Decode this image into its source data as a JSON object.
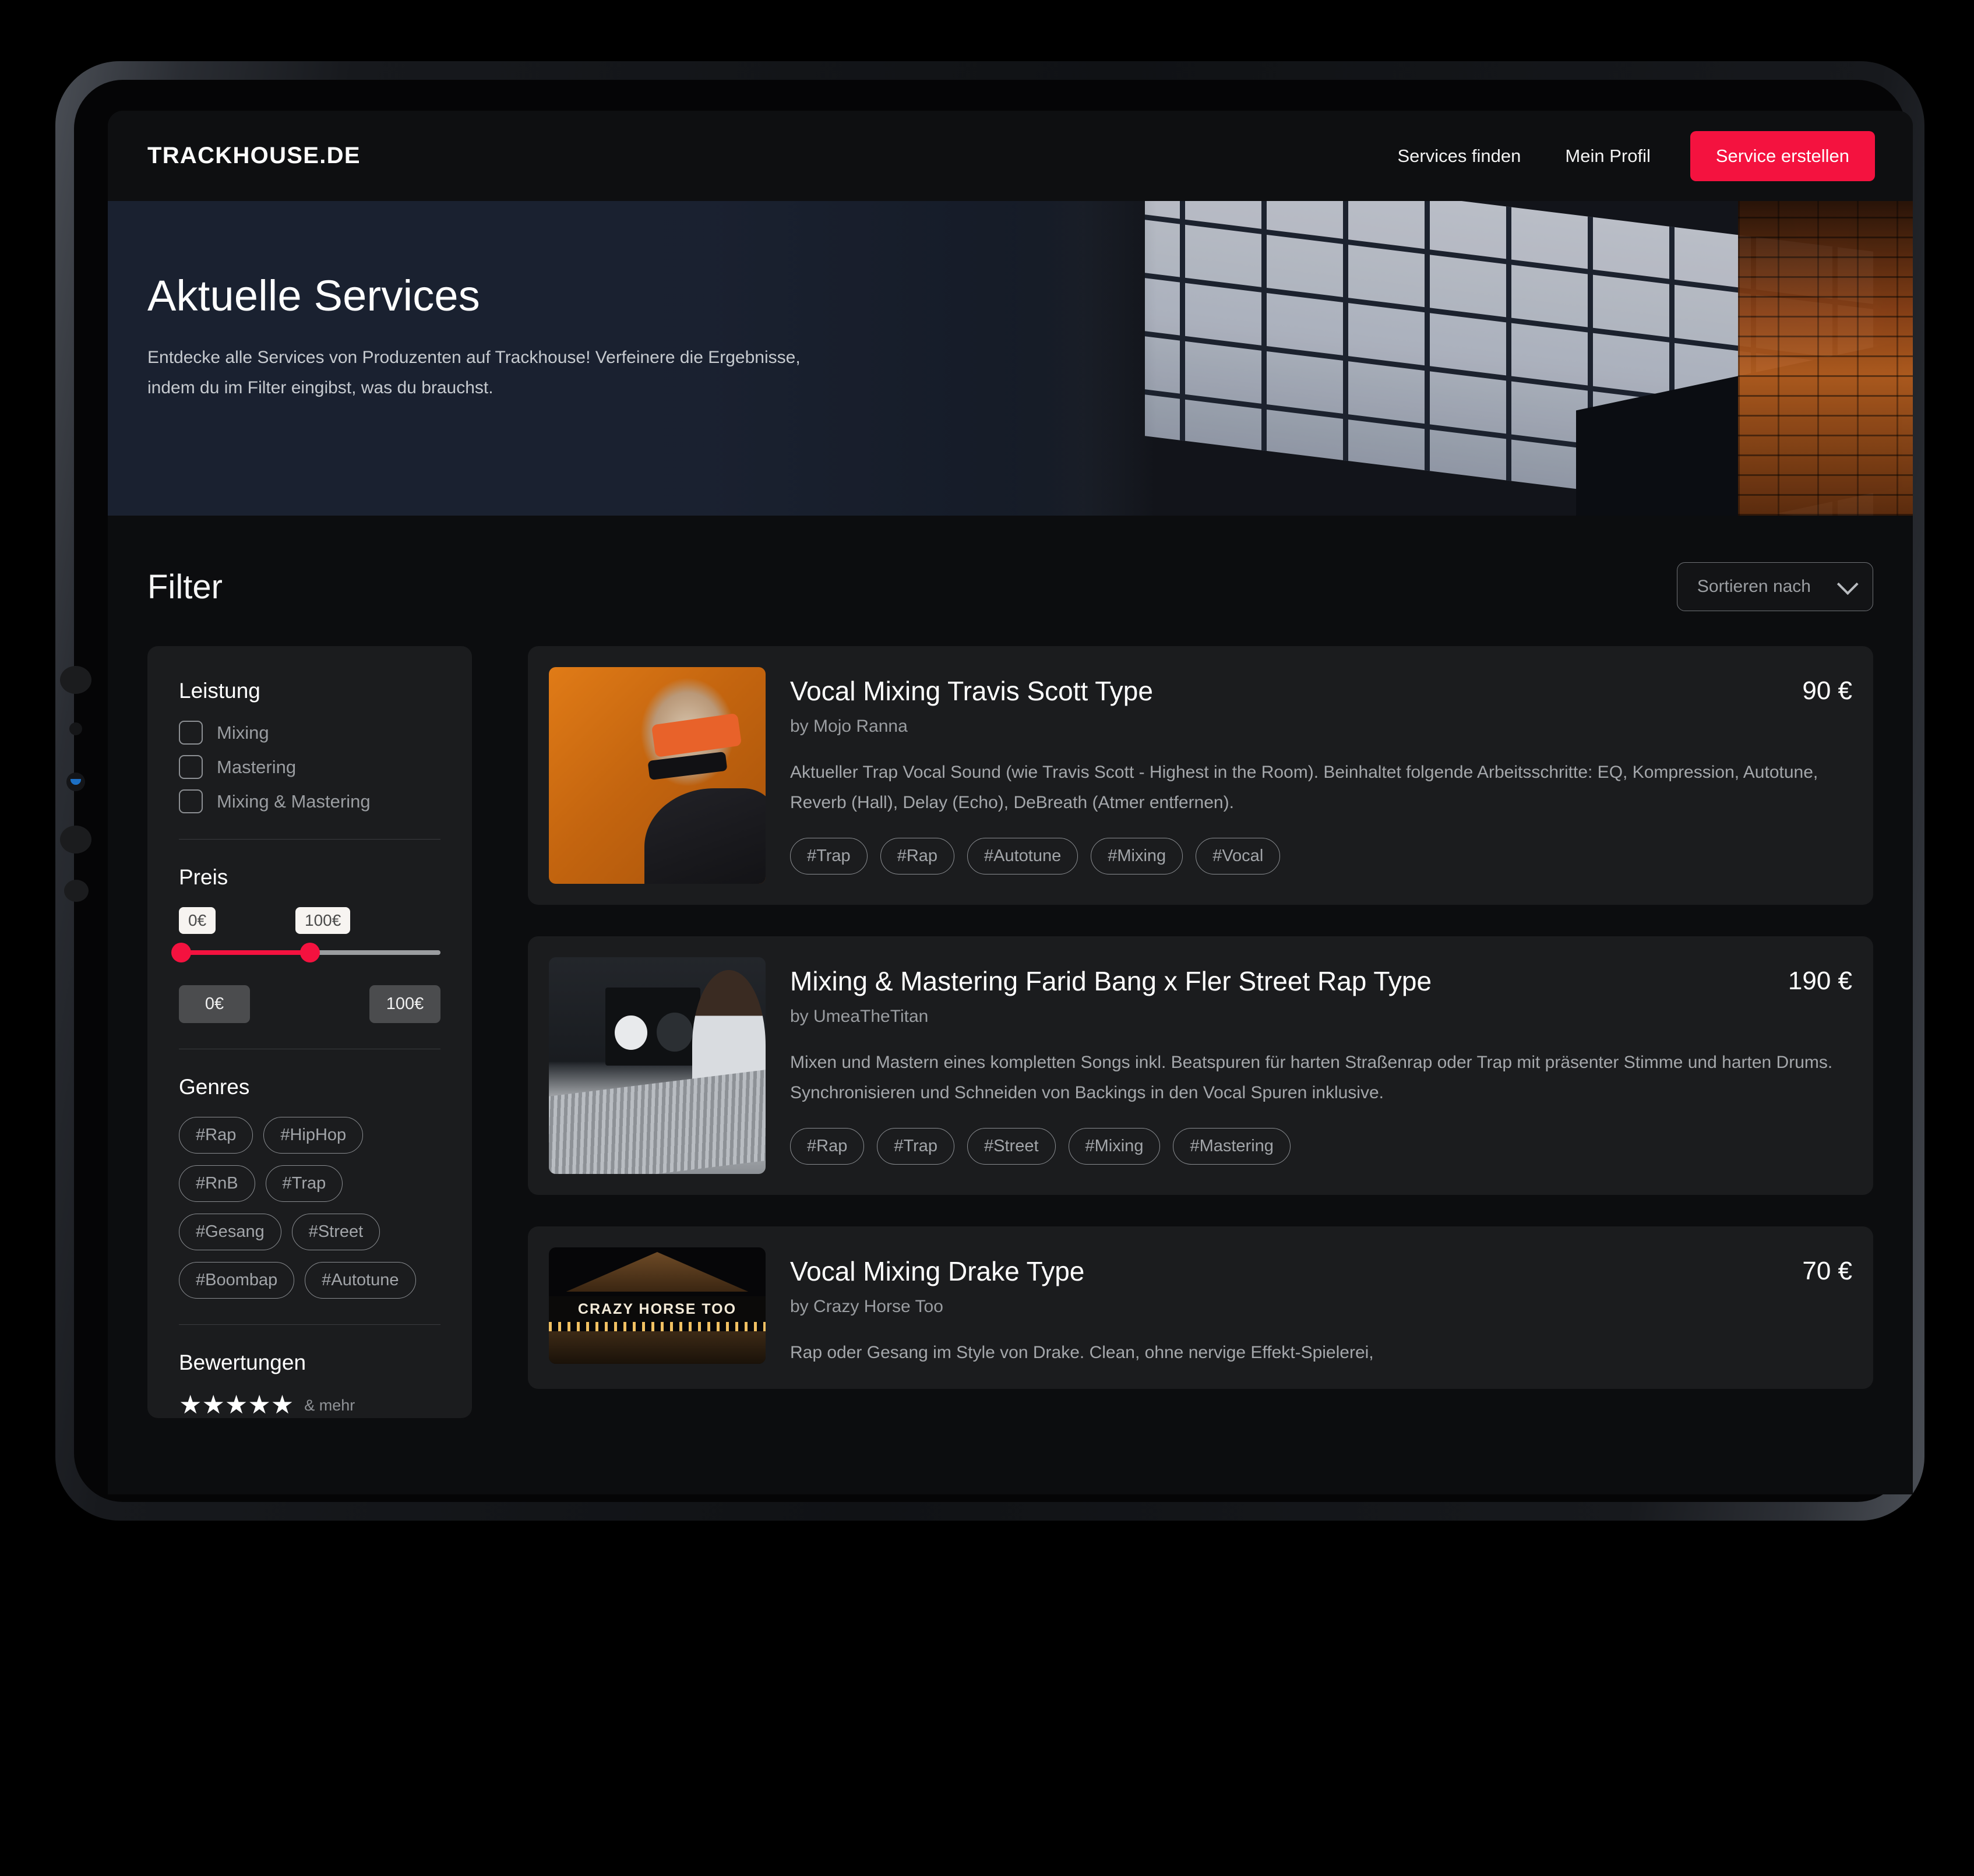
{
  "nav": {
    "brand": "TRACKHOUSE.DE",
    "links": [
      {
        "label": "Services finden"
      },
      {
        "label": "Mein Profil"
      }
    ],
    "cta_label": "Service erstellen",
    "cta_color": "#f4123f"
  },
  "hero": {
    "title": "Aktuelle Services",
    "subtitle": "Entdecke alle Services von Produzenten auf Trackhouse! Verfeinere die Ergebnisse, indem du im Filter eingibst, was du brauchst."
  },
  "content": {
    "page_title": "Filter",
    "sort": {
      "label": "Sortieren nach",
      "icon": "chevron-down-icon"
    }
  },
  "filter": {
    "leistung": {
      "title": "Leistung",
      "options": [
        {
          "label": "Mixing",
          "checked": false
        },
        {
          "label": "Mastering",
          "checked": false
        },
        {
          "label": "Mixing & Mastering",
          "checked": false
        }
      ]
    },
    "preis": {
      "title": "Preis",
      "bubble_min": "0€",
      "bubble_max": "100€",
      "input_min": "0€",
      "input_max": "100€",
      "slider_min_pct": 0,
      "slider_max_pct": 50,
      "accent": "#f4123f"
    },
    "genres": {
      "title": "Genres",
      "chips": [
        "#Rap",
        "#HipHop",
        "#RnB",
        "#Trap",
        "#Gesang",
        "#Street",
        "#Boombap",
        "#Autotune"
      ]
    },
    "bewertungen": {
      "title": "Bewertungen",
      "stars": "★★★★★",
      "star_count": 5,
      "more_label": "& mehr"
    }
  },
  "services": [
    {
      "title": "Vocal Mixing Travis Scott Type",
      "author": "by Mojo Ranna",
      "price": "90 €",
      "description": "Aktueller Trap Vocal Sound (wie Travis Scott - Highest in the Room). Beinhaltet folgende Arbeitsschritte: EQ, Kompression, Autotune, Reverb (Hall), Delay (Echo), DeBreath (Atmer entfernen).",
      "tags": [
        "#Trap",
        "#Rap",
        "#Autotune",
        "#Mixing",
        "#Vocal"
      ],
      "thumb": "rapper-orange-portrait"
    },
    {
      "title": "Mixing & Mastering Farid Bang x Fler Street Rap Type",
      "author": "by UmeaTheTitan",
      "price": "190 €",
      "description": "Mixen und Mastern eines kompletten Songs inkl. Beatspuren für harten Straßenrap oder Trap mit präsenter Stimme und harten Drums. Synchronisieren und Schneiden von Backings in den Vocal Spuren inklusive.",
      "tags": [
        "#Rap",
        "#Trap",
        "#Street",
        "#Mixing",
        "#Mastering"
      ],
      "thumb": "studio-mixing-console"
    },
    {
      "title": "Vocal Mixing Drake Type",
      "author": "by Crazy Horse Too",
      "price": "70 €",
      "description": "Rap oder Gesang im Style von Drake. Clean, ohne nervige Effekt-Spielerei,",
      "tags": [],
      "thumb": "crazy-horse-too-club",
      "thumb_caption": "CRAZY HORSE TOO"
    }
  ]
}
